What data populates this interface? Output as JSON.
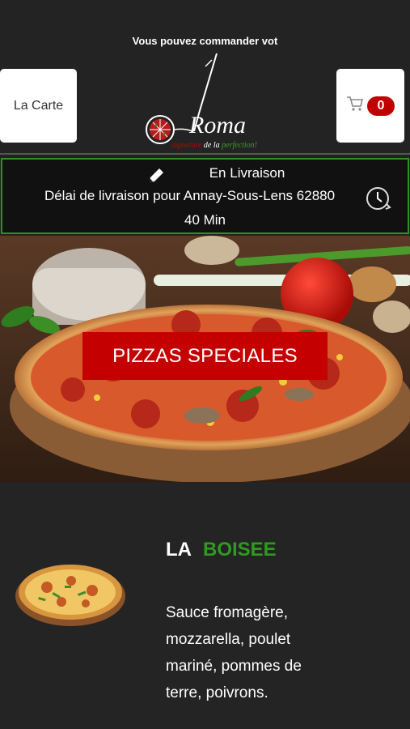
{
  "header": {
    "marquee": "Vous pouvez commander vot",
    "menu_button": "La Carte",
    "cart_count": "0",
    "logo_text": "Roma",
    "logo_tagline": {
      "part1": "signature",
      "part2": "de la",
      "part3": "perfection!"
    }
  },
  "delivery": {
    "mode": "En Livraison",
    "city_line": "Délai de livraison pour Annay-Sous-Lens 62880",
    "time": "40 Min"
  },
  "hero": {
    "category_button": "PIZZAS SPECIALES"
  },
  "product": {
    "title_part1": "LA",
    "title_part2": "BOISEE",
    "description": "Sauce fromagère, mozzarella, poulet mariné, pommes de terre, poivrons."
  },
  "colors": {
    "accent_red": "#c40000",
    "accent_green": "#2f9a1f",
    "background": "#222222"
  },
  "icons": [
    "cart-icon",
    "pencil-icon",
    "clock-icon"
  ]
}
